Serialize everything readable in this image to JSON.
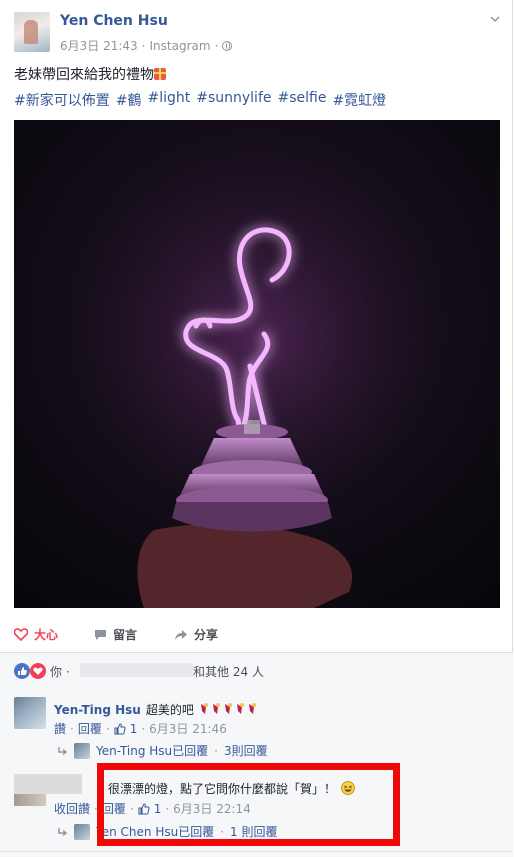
{
  "post": {
    "author": "Yen Chen Hsu",
    "timestamp": "6月3日 21:43",
    "separator": " · ",
    "source": "Instagram",
    "text": "老妹帶回來給我的禮物",
    "hashtags": [
      "#新家可以佈置",
      "#鶴",
      "#light",
      "#sunnylife",
      "#selfie",
      "#霓虹燈"
    ]
  },
  "actions": {
    "like": "大心",
    "comment": "留言",
    "share": "分享"
  },
  "reactions": {
    "prefix": "你 ·",
    "suffix": "和其他 24 人"
  },
  "comments": [
    {
      "author": "Yen-Ting Hsu",
      "text": "超美的吧",
      "like_label": "讚",
      "reply_label": "回覆",
      "like_count": "1",
      "time": "6月3日 21:46",
      "reply_summary": "Yen-Ting Hsu已回覆",
      "reply_count": "3則回覆"
    },
    {
      "author": "",
      "text": "很漂漂的燈，點了它問你什麼都說「賀」！",
      "like_label": "收回讚",
      "reply_label": "回覆",
      "like_count": "1",
      "time": "6月3日 22:14",
      "reply_summary": "Yen Chen Hsu已回覆",
      "reply_count": "1 則回覆"
    }
  ],
  "colors": {
    "link": "#365899",
    "muted": "#90949c",
    "highlight": "#f00909",
    "neon": "#f3b6ff"
  }
}
